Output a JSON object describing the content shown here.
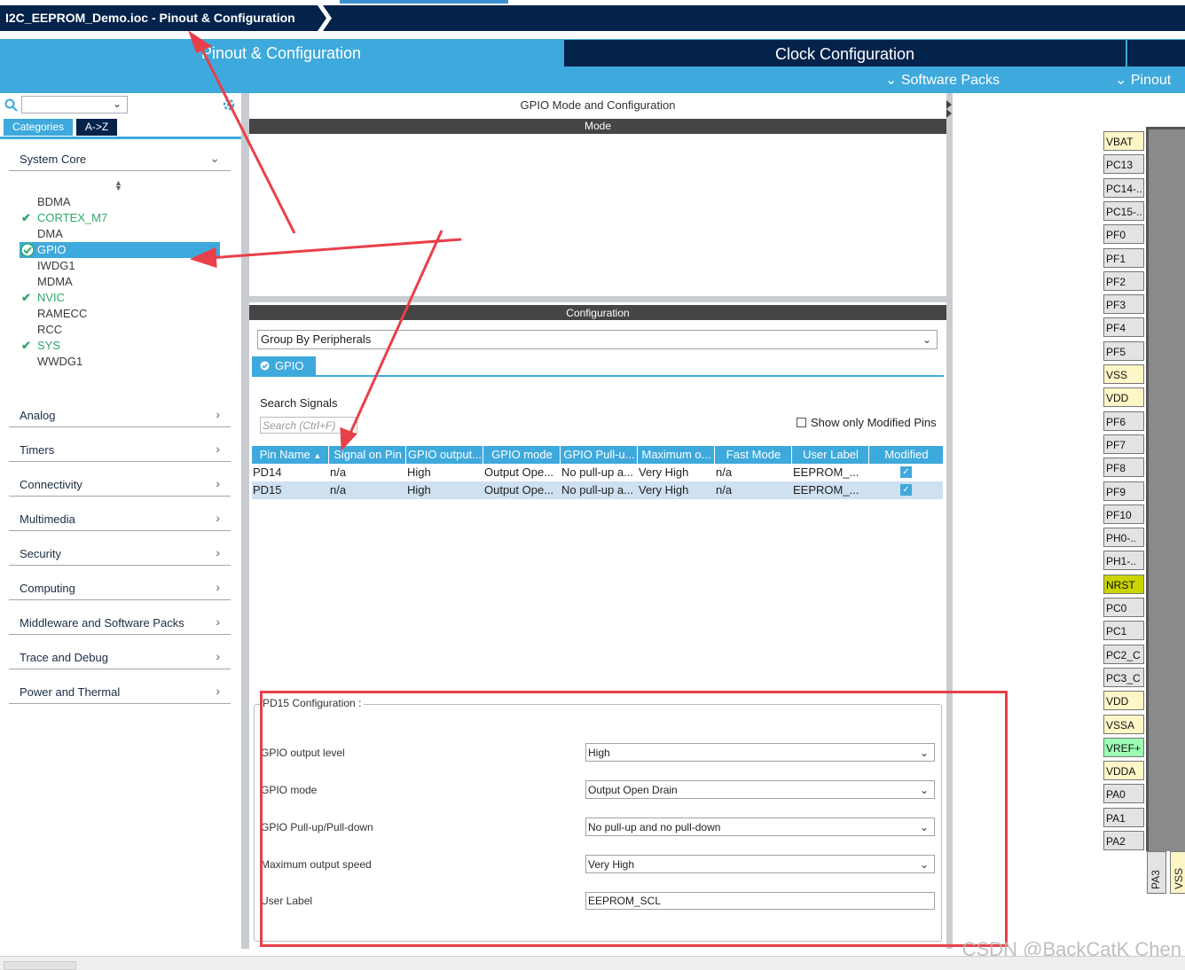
{
  "window": {
    "title": "I2C_EEPROM_Demo.ioc - Pinout & Configuration"
  },
  "main_tabs": {
    "pinout": "Pinout & Configuration",
    "clock": "Clock Configuration"
  },
  "subbar": {
    "software_packs": "Software Packs",
    "pinout": "Pinout"
  },
  "left": {
    "tab_categories": "Categories",
    "tab_az": "A->Z",
    "system_core": {
      "label": "System Core",
      "items": [
        {
          "label": "BDMA"
        },
        {
          "label": "CORTEX_M7"
        },
        {
          "label": "DMA"
        },
        {
          "label": "GPIO"
        },
        {
          "label": "IWDG1"
        },
        {
          "label": "MDMA"
        },
        {
          "label": "NVIC"
        },
        {
          "label": "RAMECC"
        },
        {
          "label": "RCC"
        },
        {
          "label": "SYS"
        },
        {
          "label": "WWDG1"
        }
      ]
    },
    "categories": [
      "Analog",
      "Timers",
      "Connectivity",
      "Multimedia",
      "Security",
      "Computing",
      "Middleware and Software Packs",
      "Trace and Debug",
      "Power and Thermal"
    ]
  },
  "center": {
    "title": "GPIO Mode and Configuration",
    "mode_bar": "Mode",
    "config_bar": "Configuration",
    "group_by": "Group By Peripherals",
    "gpio_tab": "GPIO",
    "search_signals_label": "Search Signals",
    "search_placeholder": "Search (Ctrl+F)",
    "only_modified": "Show only Modified Pins",
    "table": {
      "headers": [
        "Pin Name",
        "Signal on Pin",
        "GPIO output...",
        "GPIO mode",
        "GPIO Pull-u...",
        "Maximum o...",
        "Fast Mode",
        "User Label",
        "Modified"
      ],
      "rows": [
        [
          "PD14",
          "n/a",
          "High",
          "Output Ope...",
          "No pull-up a...",
          "Very High",
          "n/a",
          "EEPROM_...",
          "✓"
        ],
        [
          "PD15",
          "n/a",
          "High",
          "Output Ope...",
          "No pull-up a...",
          "Very High",
          "n/a",
          "EEPROM_...",
          "✓"
        ]
      ]
    },
    "pd15": {
      "legend": "PD15 Configuration :",
      "fields": [
        {
          "label": "GPIO output level",
          "value": "High"
        },
        {
          "label": "GPIO mode",
          "value": "Output Open Drain"
        },
        {
          "label": "GPIO Pull-up/Pull-down",
          "value": "No pull-up and no pull-down"
        },
        {
          "label": "Maximum output speed",
          "value": "Very High"
        },
        {
          "label": "User Label",
          "value": "EEPROM_SCL"
        }
      ]
    }
  },
  "chip": {
    "pins": [
      {
        "label": "VBAT",
        "kind": "power"
      },
      {
        "label": "PC13",
        "kind": "io"
      },
      {
        "label": "PC14-..",
        "kind": "io"
      },
      {
        "label": "PC15-..",
        "kind": "io"
      },
      {
        "label": "PF0",
        "kind": "io"
      },
      {
        "label": "PF1",
        "kind": "io"
      },
      {
        "label": "PF2",
        "kind": "io"
      },
      {
        "label": "PF3",
        "kind": "io"
      },
      {
        "label": "PF4",
        "kind": "io"
      },
      {
        "label": "PF5",
        "kind": "io"
      },
      {
        "label": "VSS",
        "kind": "power"
      },
      {
        "label": "VDD",
        "kind": "power"
      },
      {
        "label": "PF6",
        "kind": "io"
      },
      {
        "label": "PF7",
        "kind": "io"
      },
      {
        "label": "PF8",
        "kind": "io"
      },
      {
        "label": "PF9",
        "kind": "io"
      },
      {
        "label": "PF10",
        "kind": "io"
      },
      {
        "label": "PH0-..",
        "kind": "io"
      },
      {
        "label": "PH1-..",
        "kind": "io"
      },
      {
        "label": "NRST",
        "kind": "reset"
      },
      {
        "label": "PC0",
        "kind": "io"
      },
      {
        "label": "PC1",
        "kind": "io"
      },
      {
        "label": "PC2_C",
        "kind": "io"
      },
      {
        "label": "PC3_C",
        "kind": "io"
      },
      {
        "label": "VDD",
        "kind": "power"
      },
      {
        "label": "VSSA",
        "kind": "power"
      },
      {
        "label": "VREF+",
        "kind": "ref"
      },
      {
        "label": "VDDA",
        "kind": "power"
      },
      {
        "label": "PA0",
        "kind": "io"
      },
      {
        "label": "PA1",
        "kind": "io"
      },
      {
        "label": "PA2",
        "kind": "io"
      }
    ],
    "bottom_pins": [
      "PA3",
      "VSS"
    ]
  },
  "colors": {
    "accent": "#3ea9dc",
    "dark": "#03234b",
    "annotation": "#e8404a",
    "ok": "#30a86a"
  },
  "watermark": "CSDN @BackCatK Chen"
}
